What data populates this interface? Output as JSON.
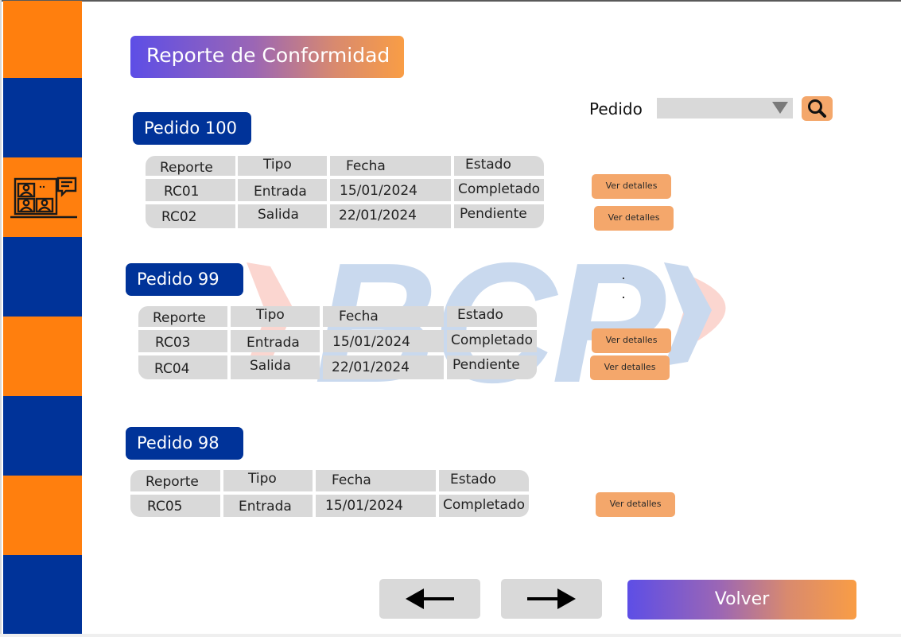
{
  "header": {
    "title": "Reporte de Conformidad"
  },
  "search": {
    "label": "Pedido",
    "selected_value": ""
  },
  "table_headers": {
    "reporte": "Reporte",
    "tipo": "Tipo",
    "fecha": "Fecha",
    "estado": "Estado"
  },
  "groups": [
    {
      "label": "Pedido 100",
      "rows": [
        {
          "reporte": "RC01",
          "tipo": "Entrada",
          "fecha": "15/01/2024",
          "estado": "Completado",
          "action": "Ver detalles"
        },
        {
          "reporte": "RC02",
          "tipo": "Salida",
          "fecha": "22/01/2024",
          "estado": "Pendiente",
          "action": "Ver detalles"
        }
      ]
    },
    {
      "label": "Pedido 99",
      "rows": [
        {
          "reporte": "RC03",
          "tipo": "Entrada",
          "fecha": "15/01/2024",
          "estado": "Completado",
          "action": "Ver detalles"
        },
        {
          "reporte": "RC04",
          "tipo": "Salida",
          "fecha": "22/01/2024",
          "estado": "Pendiente",
          "action": "Ver detalles"
        }
      ]
    },
    {
      "label": "Pedido 98",
      "rows": [
        {
          "reporte": "RC05",
          "tipo": "Entrada",
          "fecha": "15/01/2024",
          "estado": "Completado",
          "action": "Ver detalles"
        }
      ]
    }
  ],
  "footer": {
    "back_icon": "arrow-left-icon",
    "next_icon": "arrow-right-icon",
    "volver_label": "Volver"
  },
  "watermark": {
    "text": "BCP"
  },
  "colors": {
    "sidebar_orange": "#ff7f0e",
    "sidebar_blue": "#003399",
    "button_orange": "#f4a76b",
    "gradient_start": "#5d4ee6",
    "gradient_end": "#f99d45",
    "cell_gray": "#d9d9d9"
  },
  "icons": {
    "sidebar": "video-conference-icon",
    "search": "search-icon",
    "dropdown": "dropdown-arrow-icon"
  }
}
